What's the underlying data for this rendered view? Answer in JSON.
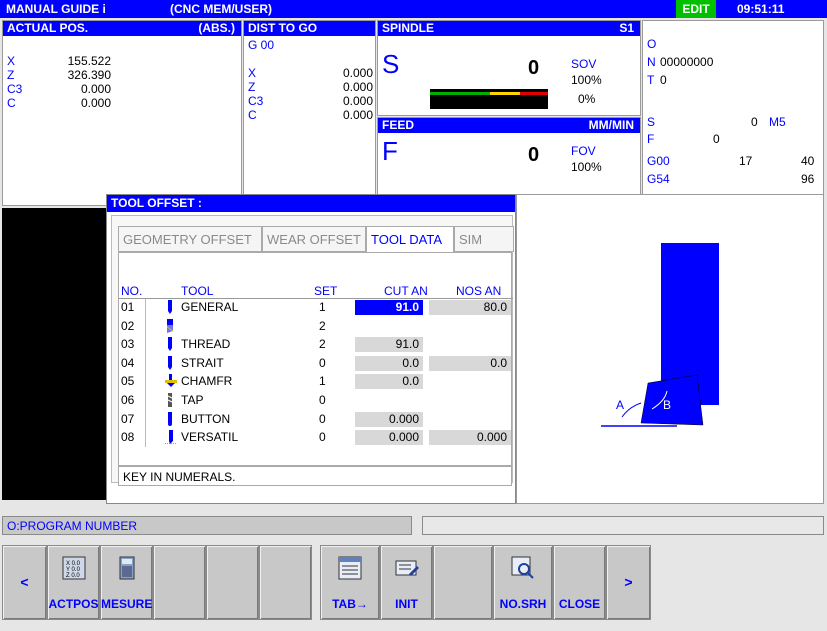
{
  "titlebar": {
    "app": "MANUAL GUIDE i",
    "path": "(CNC  MEM/USER)",
    "mode": "EDIT",
    "time": "09:51:11"
  },
  "actual_pos": {
    "title": "ACTUAL POS.",
    "mode": "(ABS.)",
    "axes": [
      {
        "axis": "X",
        "value": "155.522"
      },
      {
        "axis": "Z",
        "value": "326.390"
      },
      {
        "axis": "C3",
        "value": "0.000"
      },
      {
        "axis": "C",
        "value": "0.000"
      }
    ]
  },
  "dist_to_go": {
    "title": "DIST TO GO",
    "g": "G  00",
    "axes": [
      {
        "axis": "X",
        "value": "0.000"
      },
      {
        "axis": "Z",
        "value": "0.000"
      },
      {
        "axis": "C3",
        "value": "0.000"
      },
      {
        "axis": "C",
        "value": "0.000"
      }
    ]
  },
  "spindle": {
    "title": "SPINDLE",
    "id": "S1",
    "letter": "S",
    "value": "0",
    "sov_label": "SOV",
    "sov_value": "100%",
    "load": "0%"
  },
  "feed": {
    "title": "FEED",
    "unit": "MM/MIN",
    "letter": "F",
    "value": "0",
    "fov_label": "FOV",
    "fov_value": "100%"
  },
  "modal": {
    "o": "O",
    "n_label": "N",
    "n_value": "00000000",
    "t_label": "T",
    "t_value": "0",
    "s_label": "S",
    "s_value": "0",
    "m_label": "M5",
    "f_label": "F",
    "f_value": "0",
    "g1": "G00",
    "g1a": "17",
    "g1b": "40",
    "g2": "G54",
    "g2b": "96"
  },
  "tool_offset": {
    "title": "TOOL OFFSET :",
    "tabs": [
      "GEOMETRY OFFSET",
      "WEAR OFFSET",
      "TOOL DATA",
      "SIM DAT"
    ],
    "active_tab": "TOOL DATA",
    "columns": [
      "NO.",
      "TOOL",
      "SET",
      "CUT AN",
      "NOS AN"
    ],
    "rows": [
      {
        "no": "01",
        "tool": "GENERAL",
        "set": "1",
        "cut": "91.0",
        "nos": "80.0",
        "icon": "general-tool-icon"
      },
      {
        "no": "02",
        "tool": "",
        "set": "2",
        "cut": "",
        "nos": "",
        "icon": "grooving-tool-icon"
      },
      {
        "no": "03",
        "tool": "THREAD",
        "set": "2",
        "cut": "91.0",
        "nos": "",
        "icon": "thread-tool-icon"
      },
      {
        "no": "04",
        "tool": "STRAIT",
        "set": "0",
        "cut": "0.0",
        "nos": "0.0",
        "icon": "strait-tool-icon"
      },
      {
        "no": "05",
        "tool": "CHAMFR",
        "set": "1",
        "cut": "0.0",
        "nos": "",
        "icon": "chamfer-tool-icon"
      },
      {
        "no": "06",
        "tool": "TAP",
        "set": "0",
        "cut": "",
        "nos": "",
        "icon": "tap-tool-icon"
      },
      {
        "no": "07",
        "tool": "BUTTON",
        "set": "0",
        "cut": "0.000",
        "nos": "",
        "icon": "button-tool-icon"
      },
      {
        "no": "08",
        "tool": "VERSATIL",
        "set": "0",
        "cut": "0.000",
        "nos": "0.000",
        "icon": "versatile-tool-icon"
      }
    ],
    "message": "KEY IN NUMERALS."
  },
  "diagram": {
    "angle_a": "A",
    "angle_b": "B"
  },
  "status": {
    "program_number": "O:PROGRAM NUMBER"
  },
  "softkeys": [
    {
      "label": "<",
      "kind": "arrow"
    },
    {
      "label": "ACTPOS",
      "kind": "key",
      "icon": "actpos-icon"
    },
    {
      "label": "MESURE",
      "kind": "key",
      "icon": "calculator-icon"
    },
    {
      "label": "",
      "kind": "blank"
    },
    {
      "label": "",
      "kind": "blank"
    },
    {
      "label": "",
      "kind": "blank"
    },
    {
      "label": "TAB→",
      "kind": "key",
      "icon": "tab-icon"
    },
    {
      "label": "INIT",
      "kind": "key",
      "icon": "init-icon"
    },
    {
      "label": "",
      "kind": "blank"
    },
    {
      "label": "NO.SRH",
      "kind": "key",
      "icon": "search-icon"
    },
    {
      "label": "CLOSE",
      "kind": "key"
    },
    {
      "label": ">",
      "kind": "arrow"
    }
  ],
  "colors": {
    "accent": "#0000ff",
    "highlight": "#0000ff",
    "yellow": "#ffd700",
    "green": "#00b000",
    "red": "#e00000"
  }
}
